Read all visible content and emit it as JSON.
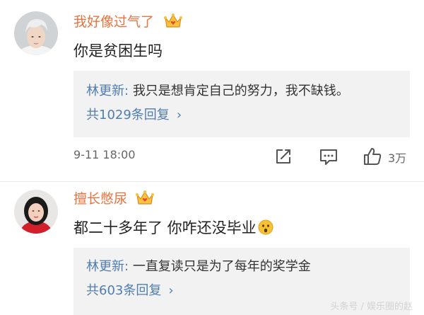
{
  "colors": {
    "username": "#eb7340",
    "link": "#507daf",
    "reply_bg": "#f2f2f2",
    "meta": "#666666"
  },
  "comments": [
    {
      "username": "我好像过气了",
      "badge_icon": "vip-crown-icon",
      "text": "你是贫困生吗",
      "reply": {
        "author": "林更新:",
        "text": "我只是想肯定自己的努力，我不缺钱。"
      },
      "reply_count_label": "共1029条回复",
      "timestamp": "9-11 18:00",
      "actions": {
        "share_icon": "share-icon",
        "comment_icon": "comment-icon",
        "like_icon": "thumbs-up-icon",
        "like_count": "3万"
      }
    },
    {
      "username": "擅长憋尿",
      "badge_icon": "vip-crown-icon",
      "text": "都二十多年了 你咋还没毕业",
      "emoji": "surprised-face-emoji",
      "reply": {
        "author": "林更新:",
        "text": "一直复读只是为了每年的奖学金"
      },
      "reply_count_label": "共603条回复"
    }
  ],
  "watermark": "头条号 / 娱乐圈的赵"
}
